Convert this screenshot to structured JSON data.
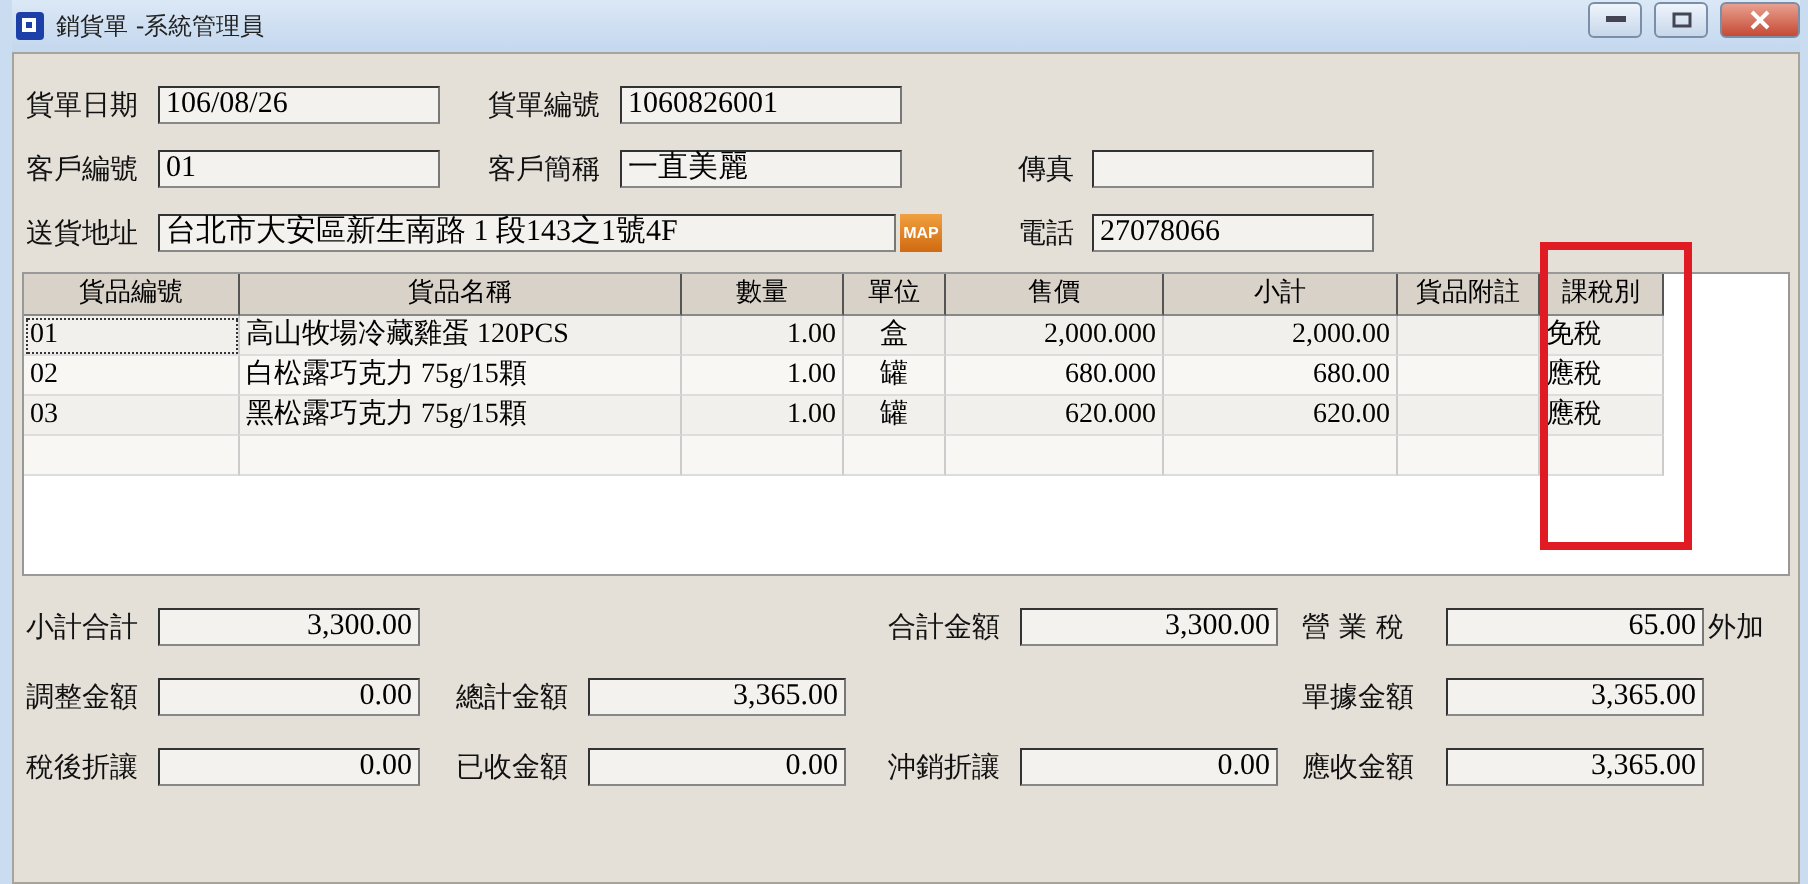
{
  "window": {
    "title": "銷貨單 -系統管理員"
  },
  "header_fields": [
    {
      "kind": "text",
      "label": "貨單日期",
      "value": "106/08/26"
    },
    {
      "kind": "text",
      "label": "貨單編號",
      "value": "1060826001"
    },
    {
      "kind": "blank"
    },
    {
      "kind": "text",
      "label": "客戶編號",
      "value": "01"
    },
    {
      "kind": "text",
      "label": "客戶簡稱",
      "value": "一直美麗"
    },
    {
      "kind": "text",
      "label": "傳真"
    },
    {
      "kind": "address",
      "label": "送貨地址",
      "value": "台北市大安區新生南路 1 段143之1號4F",
      "button": "MAP"
    },
    {
      "kind": "text",
      "label": "電話",
      "value": "27078066"
    }
  ],
  "table": {
    "columns": [
      {
        "label": "貨品編號",
        "highlighted": false
      },
      {
        "label": "貨品名稱",
        "highlighted": false
      },
      {
        "label": "數量",
        "highlighted": false
      },
      {
        "label": "單位",
        "highlighted": false
      },
      {
        "label": "售價",
        "highlighted": false
      },
      {
        "label": "小計",
        "highlighted": false
      },
      {
        "label": "貨品附註",
        "highlighted": false
      },
      {
        "label": "課稅別",
        "highlighted": true
      }
    ],
    "rows": [
      {
        "focused": true,
        "cells": [
          "01",
          "高山牧場冷藏雞蛋 120PCS",
          "1.00",
          "盒",
          "2,000.000",
          "2,000.00",
          "",
          "免稅"
        ]
      },
      {
        "focused": false,
        "cells": [
          "02",
          "白松露巧克力 75g/15顆",
          "1.00",
          "罐",
          "680.000",
          "680.00",
          "",
          "應稅"
        ]
      },
      {
        "focused": false,
        "cells": [
          "03",
          "黑松露巧克力 75g/15顆",
          "1.00",
          "罐",
          "620.000",
          "620.00",
          "",
          "應稅"
        ]
      },
      {
        "focused": false,
        "kind": "blank"
      }
    ]
  },
  "summary": [
    [
      {
        "label": "小計合計",
        "value": "3,300.00"
      },
      {
        "kind": "blank"
      },
      {
        "label": "合計金額",
        "value": "3,300.00"
      },
      {
        "label": "營 業 稅",
        "value": "65.00",
        "suffix": "外加"
      }
    ],
    [
      {
        "label": "調整金額",
        "value": "0.00"
      },
      {
        "label": "總計金額",
        "value": "3,365.00"
      },
      {
        "kind": "blank"
      },
      {
        "label": "單據金額",
        "value": "3,365.00"
      }
    ],
    [
      {
        "label": "稅後折讓",
        "value": "0.00"
      },
      {
        "label": "已收金額",
        "value": "0.00"
      },
      {
        "label": "沖銷折讓",
        "value": "0.00"
      },
      {
        "label": "應收金額",
        "value": "3,365.00"
      }
    ]
  ]
}
